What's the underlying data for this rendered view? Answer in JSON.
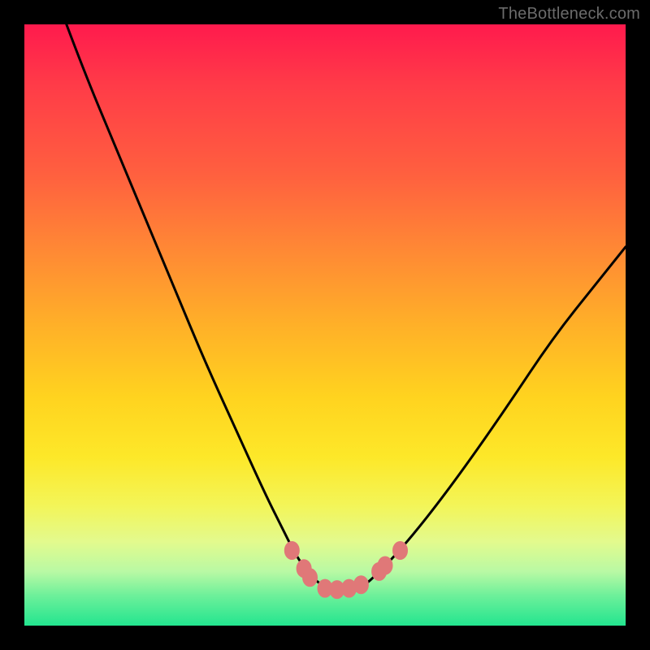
{
  "watermark": "TheBottleneck.com",
  "colors": {
    "background": "#000000",
    "curve_stroke": "#000000",
    "marker_fill": "#e07878",
    "marker_stroke": "#e07878"
  },
  "chart_data": {
    "type": "line",
    "title": "",
    "xlabel": "",
    "ylabel": "",
    "xlim": [
      0,
      100
    ],
    "ylim": [
      0,
      100
    ],
    "grid": false,
    "series": [
      {
        "name": "bottleneck-curve",
        "x": [
          7,
          10,
          15,
          20,
          25,
          30,
          35,
          40,
          43,
          45,
          47,
          49,
          51,
          53,
          55,
          57,
          59,
          62,
          67,
          73,
          80,
          88,
          96,
          100
        ],
        "values": [
          100,
          92,
          80,
          68,
          56,
          44,
          33,
          22,
          16,
          12,
          9,
          7,
          6,
          6,
          6,
          7,
          9,
          12,
          18,
          26,
          36,
          48,
          58,
          63
        ]
      }
    ],
    "markers": [
      {
        "x": 44.5,
        "y": 12.5
      },
      {
        "x": 46.5,
        "y": 9.5
      },
      {
        "x": 47.5,
        "y": 8.0
      },
      {
        "x": 50.0,
        "y": 6.2
      },
      {
        "x": 52.0,
        "y": 6.0
      },
      {
        "x": 54.0,
        "y": 6.2
      },
      {
        "x": 56.0,
        "y": 6.8
      },
      {
        "x": 59.0,
        "y": 9.0
      },
      {
        "x": 60.0,
        "y": 10.0
      },
      {
        "x": 62.5,
        "y": 12.5
      }
    ]
  }
}
